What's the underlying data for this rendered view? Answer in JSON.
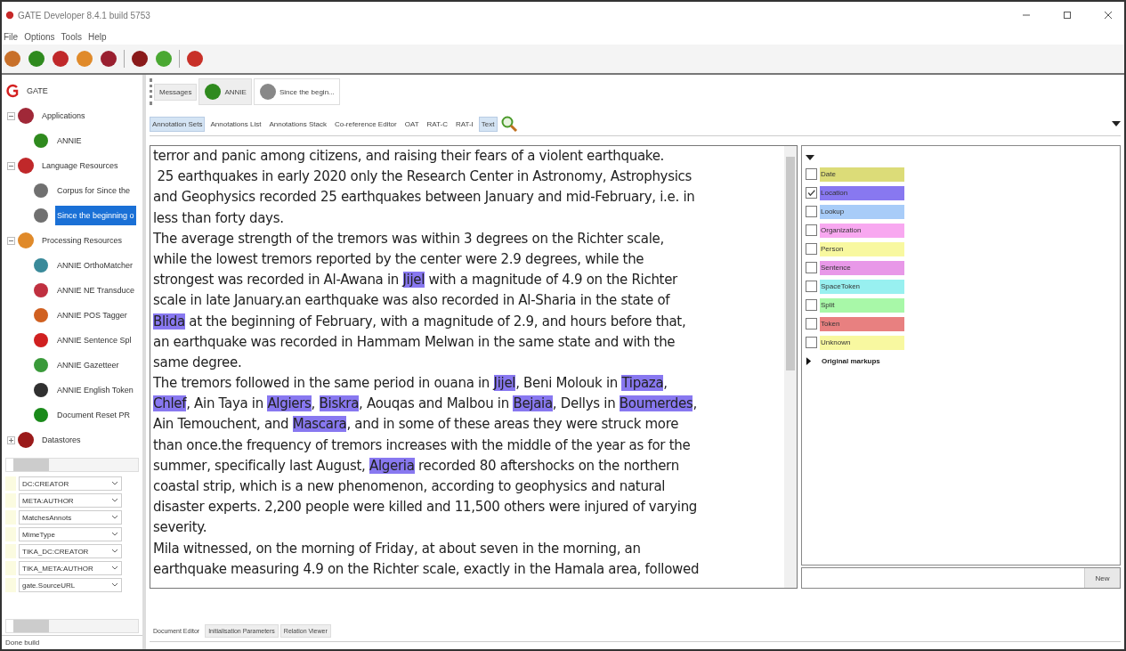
{
  "window": {
    "title": "GATE Developer 8.4.1 build 5753"
  },
  "menu": [
    "File",
    "Options",
    "Tools",
    "Help"
  ],
  "toolbar": [
    {
      "color": "#c8702a"
    },
    {
      "color": "#2f8a1e"
    },
    {
      "color": "#c0282a"
    },
    {
      "color": "#e08a2a"
    },
    {
      "color": "#9a2030"
    },
    {
      "color": "#8a1a1a"
    },
    {
      "color": "#4aa832"
    },
    {
      "color": "#c83028"
    }
  ],
  "tree": {
    "label": "GATE",
    "children": [
      {
        "label": "Applications",
        "color": "#a02838",
        "expanded": true,
        "selected": false,
        "children": [
          {
            "label": "ANNIE",
            "color": "#2f8a1e",
            "selected": false
          }
        ]
      },
      {
        "label": "Language Resources",
        "color": "#c0282a",
        "expanded": true,
        "selected": false,
        "children": [
          {
            "label": "Corpus for Since the",
            "color": "#707070",
            "selected": false
          },
          {
            "label": "Since the beginning o",
            "color": "#707070",
            "selected": true
          }
        ]
      },
      {
        "label": "Processing Resources",
        "color": "#e08a2a",
        "expanded": true,
        "selected": false,
        "children": [
          {
            "label": "ANNIE OrthoMatcher",
            "color": "#3a8a9a",
            "selected": false
          },
          {
            "label": "ANNIE NE Transduce",
            "color": "#c03040",
            "selected": false
          },
          {
            "label": "ANNIE POS Tagger",
            "color": "#d06020",
            "selected": false
          },
          {
            "label": "ANNIE Sentence Spl",
            "color": "#d02020",
            "selected": false
          },
          {
            "label": "ANNIE Gazetteer",
            "color": "#3a9a3a",
            "selected": false
          },
          {
            "label": "ANNIE English Token",
            "color": "#303030",
            "selected": false
          },
          {
            "label": "Document Reset PR",
            "color": "#1a8a1a",
            "selected": false
          }
        ]
      },
      {
        "label": "Datastores",
        "color": "#9a1a1a",
        "expanded": false,
        "selected": false
      }
    ]
  },
  "features": [
    "DC:CREATOR",
    "META:AUTHOR",
    "MatchesAnnots",
    "MimeType",
    "TIKA_DC:CREATOR",
    "TIKA_META:AUTHOR",
    "gate.SourceURL"
  ],
  "status_bar": "Done build",
  "resource_tabs": [
    {
      "label": "Messages",
      "selected": false
    },
    {
      "label": "ANNIE",
      "selected": false
    },
    {
      "label": "Since the begin...",
      "selected": true
    }
  ],
  "view_buttons": [
    {
      "label": "Annotation Sets",
      "selected": true
    },
    {
      "label": "Annotations List",
      "selected": false
    },
    {
      "label": "Annotations Stack",
      "selected": false
    },
    {
      "label": "Co-reference Editor",
      "selected": false
    },
    {
      "label": "OAT",
      "selected": false
    },
    {
      "label": "RAT-C",
      "selected": false
    },
    {
      "label": "RAT-I",
      "selected": false
    },
    {
      "label": "Text",
      "selected": true
    }
  ],
  "document_lines": [
    [
      {
        "text": "terror and panic among citizens, and raising their fears of a violent earthquake.",
        "highlighted": false
      }
    ],
    [
      {
        "text": " 25 earthquakes in early 2020 only the Research Center in Astronomy, Astrophysics",
        "highlighted": false
      }
    ],
    [
      {
        "text": "and Geophysics recorded 25 earthquakes between January and mid-February, i.e. in",
        "highlighted": false
      }
    ],
    [
      {
        "text": "less than forty days.",
        "highlighted": false
      }
    ],
    [
      {
        "text": "The average strength of the tremors was within 3 degrees on the Richter scale,",
        "highlighted": false
      }
    ],
    [
      {
        "text": "while the lowest tremors reported by the center were 2.9 degrees, while the",
        "highlighted": false
      }
    ],
    [
      {
        "text": "strongest was recorded in Al-Awana in ",
        "highlighted": false
      },
      {
        "text": "Jijel",
        "highlighted": true
      },
      {
        "text": " with a magnitude of 4.9 on the Richter",
        "highlighted": false
      }
    ],
    [
      {
        "text": "scale in late January.an earthquake was also recorded in Al-Sharia in the state of",
        "highlighted": false
      }
    ],
    [
      {
        "text": "Blida",
        "highlighted": true
      },
      {
        "text": " at the beginning of February, with a magnitude of 2.9, and hours before that,",
        "highlighted": false
      }
    ],
    [
      {
        "text": "an earthquake was recorded in Hammam Melwan in the same state and with the",
        "highlighted": false
      }
    ],
    [
      {
        "text": "same degree.",
        "highlighted": false
      }
    ],
    [
      {
        "text": "The tremors followed in the same period in ouana in ",
        "highlighted": false
      },
      {
        "text": "Jijel",
        "highlighted": true
      },
      {
        "text": ", Beni Molouk in ",
        "highlighted": false
      },
      {
        "text": "Tipaza",
        "highlighted": true
      },
      {
        "text": ",",
        "highlighted": false
      }
    ],
    [
      {
        "text": "Chlef",
        "highlighted": true
      },
      {
        "text": ", Ain Taya in ",
        "highlighted": false
      },
      {
        "text": "Algiers",
        "highlighted": true
      },
      {
        "text": ", ",
        "highlighted": false
      },
      {
        "text": "Biskra",
        "highlighted": true
      },
      {
        "text": ", Aouqas and Malbou in ",
        "highlighted": false
      },
      {
        "text": "Bejaia",
        "highlighted": true
      },
      {
        "text": ", Dellys in ",
        "highlighted": false
      },
      {
        "text": "Boumerdes",
        "highlighted": true
      },
      {
        "text": ",",
        "highlighted": false
      }
    ],
    [
      {
        "text": "Ain Temouchent, and ",
        "highlighted": false
      },
      {
        "text": "Mascara",
        "highlighted": true
      },
      {
        "text": ", and in some of these areas they were struck more",
        "highlighted": false
      }
    ],
    [
      {
        "text": "than once.the frequency of tremors increases with the middle of the year as for the",
        "highlighted": false
      }
    ],
    [
      {
        "text": "summer, specifically last August, ",
        "highlighted": false
      },
      {
        "text": "Algeria",
        "highlighted": true
      },
      {
        "text": " recorded 80 aftershocks on the northern",
        "highlighted": false
      }
    ],
    [
      {
        "text": "coastal strip, which is a new phenomenon, according to geophysics and natural",
        "highlighted": false
      }
    ],
    [
      {
        "text": "disaster experts. 2,200 people were killed and 11,500 others were injured of varying",
        "highlighted": false
      }
    ],
    [
      {
        "text": "severity.",
        "highlighted": false
      }
    ],
    [
      {
        "text": "Mila witnessed, on the morning of Friday, at about seven in the morning, an",
        "highlighted": false
      }
    ],
    [
      {
        "text": "earthquake measuring 4.9 on the Richter scale, exactly in the Hamala area, followed",
        "highlighted": false
      }
    ]
  ],
  "annotation_types": [
    {
      "label": "Date",
      "checked": false,
      "color": "#dcdc78"
    },
    {
      "label": "Location",
      "checked": true,
      "color": "#8878f0"
    },
    {
      "label": "Lookup",
      "checked": false,
      "color": "#a8ccf8"
    },
    {
      "label": "Organization",
      "checked": false,
      "color": "#f8a8f0"
    },
    {
      "label": "Person",
      "checked": false,
      "color": "#f8f8a0"
    },
    {
      "label": "Sentence",
      "checked": false,
      "color": "#e898e8"
    },
    {
      "label": "SpaceToken",
      "checked": false,
      "color": "#98f0f0"
    },
    {
      "label": "Split",
      "checked": false,
      "color": "#a8f8a8"
    },
    {
      "label": "Token",
      "checked": false,
      "color": "#e88080"
    },
    {
      "label": "Unknown",
      "checked": false,
      "color": "#f8f8a0"
    }
  ],
  "original_markups": {
    "label": "Original markups",
    "expanded": false
  },
  "new_button": "New",
  "bottom_tabs": [
    {
      "label": "Document Editor",
      "selected": true
    },
    {
      "label": "Initialisation Parameters",
      "selected": false
    },
    {
      "label": "Relation Viewer",
      "selected": false
    }
  ]
}
